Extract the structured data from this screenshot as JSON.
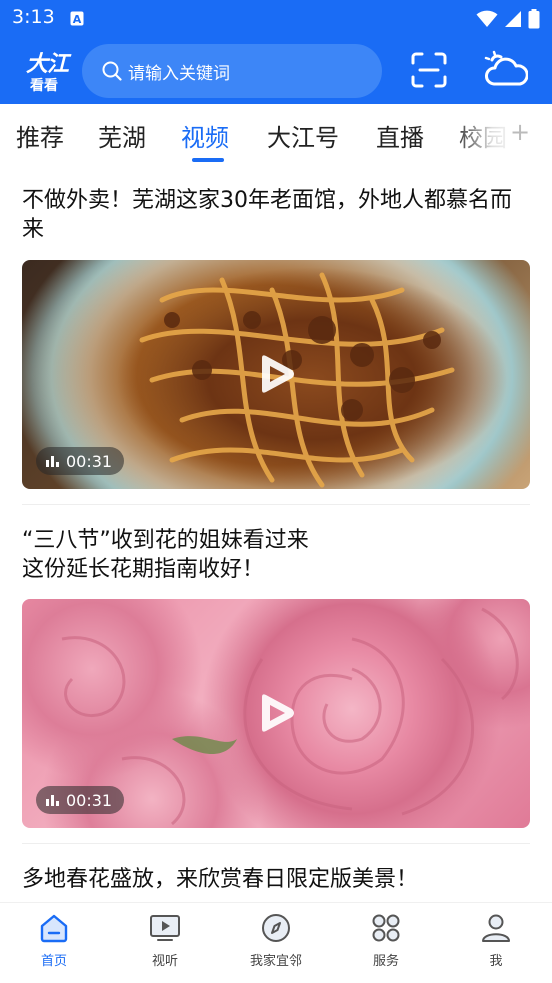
{
  "status_bar": {
    "time": "3:13"
  },
  "header": {
    "logo_line1": "大江",
    "logo_line2": "看看",
    "search_placeholder": "请输入关键词"
  },
  "tabs": [
    {
      "label": "推荐",
      "active": false
    },
    {
      "label": "芜湖",
      "active": false
    },
    {
      "label": "视频",
      "active": true
    },
    {
      "label": "大江号",
      "active": false
    },
    {
      "label": "直播",
      "active": false
    },
    {
      "label": "校园",
      "active": false
    }
  ],
  "tab_add_label": "+",
  "feed": {
    "articles": [
      {
        "title": "不做外卖！芜湖这家30年老面馆，外地人都慕名而来",
        "duration": "00:31"
      },
      {
        "title_line1": "“三八节”收到花的姐妹看过来",
        "title_line2": "这份延长花期指南收好！",
        "duration": "00:31"
      },
      {
        "title": "多地春花盛放，来欣赏春日限定版美景！"
      }
    ]
  },
  "bottom_nav": [
    {
      "label": "首页",
      "icon": "home-icon",
      "active": true
    },
    {
      "label": "视听",
      "icon": "video-screen-icon",
      "active": false
    },
    {
      "label": "我家宜邻",
      "icon": "compass-icon",
      "active": false
    },
    {
      "label": "服务",
      "icon": "grid-icon",
      "active": false
    },
    {
      "label": "我",
      "icon": "user-icon",
      "active": false
    }
  ],
  "colors": {
    "brand_blue": "#1a6cf5",
    "search_bg": "#3d86f7"
  }
}
